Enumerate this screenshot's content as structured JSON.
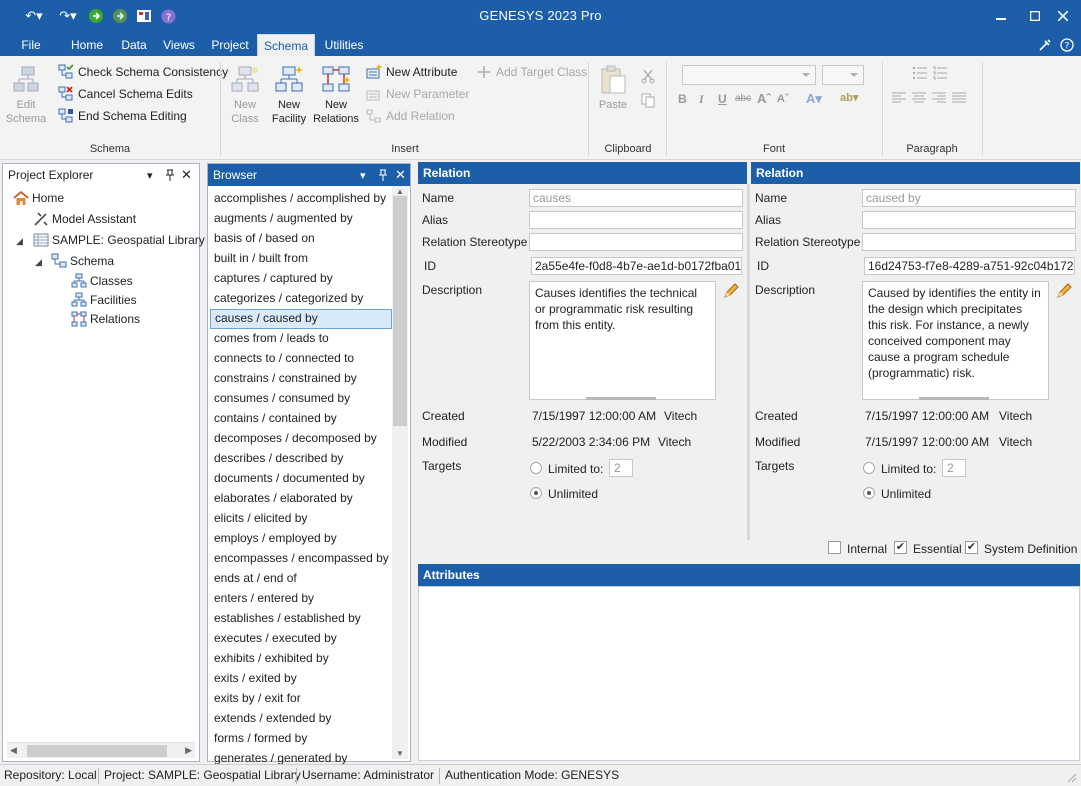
{
  "window": {
    "title": "GENESYS 2023 Pro"
  },
  "menu_tabs": [
    "File",
    "Home",
    "Data",
    "Views",
    "Project",
    "Schema",
    "Utilities"
  ],
  "ribbon": {
    "schema_group": {
      "label": "Schema",
      "edit_schema": "Edit Schema",
      "check": "Check Schema Consistency",
      "cancel": "Cancel Schema Edits",
      "end": "End Schema Editing"
    },
    "insert_group": {
      "label": "Insert",
      "new_class": "New Class",
      "new_facility": "New Facility",
      "new_relations": "New Relations",
      "new_attribute": "New Attribute",
      "new_parameter": "New Parameter",
      "add_relation": "Add Relation",
      "add_target_class": "Add Target Class"
    },
    "clipboard_group": {
      "label": "Clipboard",
      "paste": "Paste"
    },
    "font_group": {
      "label": "Font"
    },
    "paragraph_group": {
      "label": "Paragraph"
    }
  },
  "project_explorer": {
    "title": "Project Explorer",
    "home": "Home",
    "model_assistant": "Model Assistant",
    "project": "SAMPLE: Geospatial Library",
    "schema": "Schema",
    "classes": "Classes",
    "facilities": "Facilities",
    "relations": "Relations"
  },
  "browser": {
    "title": "Browser",
    "items": [
      "accomplishes / accomplished by",
      "augments / augmented by",
      "basis of / based on",
      "built in / built from",
      "captures / captured by",
      "categorizes / categorized by",
      "causes / caused by",
      "comes from / leads to",
      "connects to / connected to",
      "constrains / constrained by",
      "consumes / consumed by",
      "contains / contained by",
      "decomposes / decomposed by",
      "describes / described by",
      "documents / documented by",
      "elaborates / elaborated by",
      "elicits / elicited by",
      "employs / employed by",
      "encompasses / encompassed by",
      "ends at / end of",
      "enters / entered by",
      "establishes / established by",
      "executes / executed by",
      "exhibits / exhibited by",
      "exits / exited by",
      "exits by / exit for",
      "extends / extended by",
      "forms / formed by",
      "generates / generated by"
    ],
    "selected_index": 6
  },
  "labels": {
    "name": "Name",
    "alias": "Alias",
    "stereotype": "Relation Stereotype",
    "id": "ID",
    "description": "Description",
    "created": "Created",
    "modified": "Modified",
    "targets": "Targets",
    "limited_to": "Limited to:",
    "unlimited": "Unlimited"
  },
  "relation_left": {
    "header": "Relation",
    "name": "causes",
    "alias": "",
    "stereotype": "",
    "id": "2a55e4fe-f0d8-4b7e-ae1d-b0172fba01",
    "description": "Causes identifies the technical or programmatic risk resulting from this entity.",
    "created_date": "7/15/1997 12:00:00 AM",
    "created_by": "Vitech",
    "modified_date": "5/22/2003 2:34:06 PM",
    "modified_by": "Vitech",
    "limit": "2"
  },
  "relation_right": {
    "header": "Relation",
    "name": "caused by",
    "alias": "",
    "stereotype": "",
    "id": "16d24753-f7e8-4289-a751-92c04b172",
    "description": "Caused by identifies the entity in the design which precipitates this risk. For instance, a newly conceived component may cause a program schedule (programmatic) risk.",
    "created_date": "7/15/1997 12:00:00 AM",
    "created_by": "Vitech",
    "modified_date": "7/15/1997 12:00:00 AM",
    "modified_by": "Vitech",
    "limit": "2"
  },
  "flags": {
    "internal": "Internal",
    "essential": "Essential",
    "system_definition": "System Definition",
    "internal_checked": false,
    "essential_checked": true,
    "system_definition_checked": true
  },
  "attributes": {
    "header": "Attributes"
  },
  "statusbar": {
    "repository": "Repository: Local",
    "project": "Project: SAMPLE: Geospatial Library",
    "username": "Username: Administrator",
    "auth": "Authentication Mode: GENESYS"
  }
}
